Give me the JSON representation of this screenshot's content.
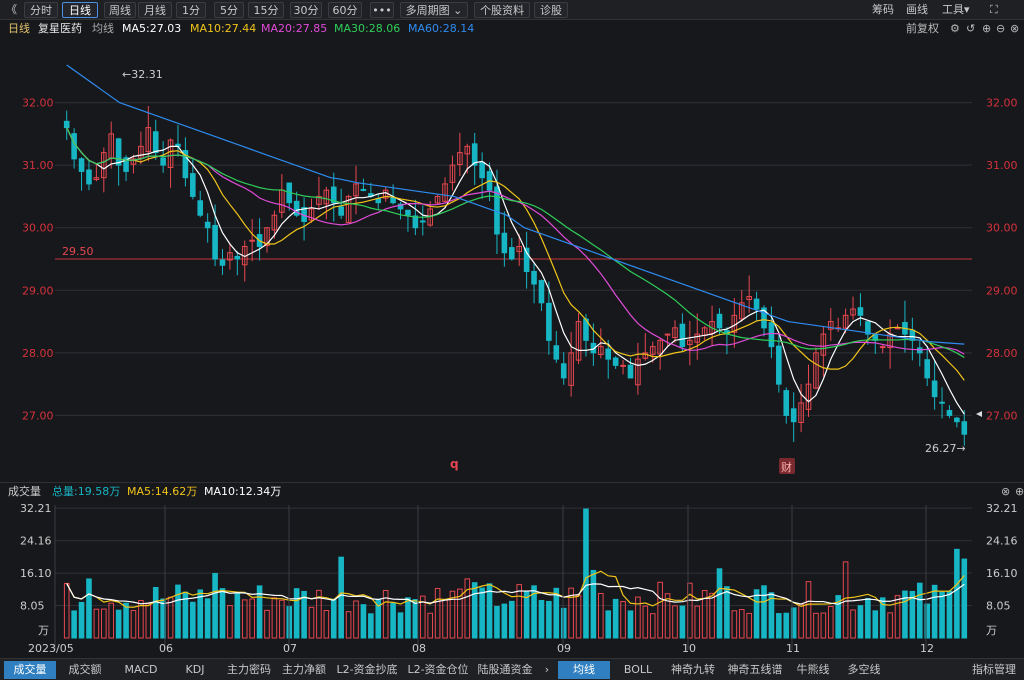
{
  "toolbar": {
    "back": "《",
    "periods": [
      "分时",
      "日线",
      "周线",
      "月线",
      "1分",
      "5分",
      "15分",
      "30分",
      "60分",
      "•••",
      "多周期图 ⌄",
      "个股资料",
      "诊股"
    ],
    "active": "日线",
    "right": [
      "筹码",
      "画线",
      "工具▾"
    ],
    "fullscreen": "⛶"
  },
  "ma_bar": {
    "period": "日线",
    "stock": "复星医药",
    "label": "均线",
    "ma5": "MA5:27.03",
    "ma10": "MA10:27.44",
    "ma20": "MA20:27.85",
    "ma30": "MA30:28.06",
    "ma60": "MA60:28.14",
    "adjust": "前复权"
  },
  "colors": {
    "up": "#e6474f",
    "down": "#17b6c4",
    "ma5": "#ffffff",
    "ma10": "#f0c419",
    "ma20": "#e04bd8",
    "ma30": "#2fce5a",
    "ma60": "#2e8cf0",
    "grid": "#2e3036",
    "axis": "#d4323c"
  },
  "volume_header": {
    "title": "成交量",
    "total": "总量:19.58万",
    "ma5": "MA5:14.62万",
    "ma10": "MA10:12.34万"
  },
  "bottom_tabs": [
    "成交量",
    "成交额",
    "MACD",
    "KDJ",
    "主力密码",
    "主力净额",
    "L2-资金抄底",
    "L2-资金仓位",
    "陆股通资金"
  ],
  "bottom_tabs_right": [
    "均线",
    "BOLL",
    "神奇九转",
    "神奇五线谱",
    "牛熊线",
    "多空线",
    "指标管理"
  ],
  "chart_data": [
    {
      "type": "candlestick",
      "title": "复星医药 日线",
      "y_ticks": [
        "32.00",
        "31.00",
        "30.00",
        "29.00",
        "28.00",
        "27.00"
      ],
      "ylim": [
        26.0,
        33.0
      ],
      "x_labels": [
        "06",
        "07",
        "08",
        "09",
        "10",
        "11",
        "12"
      ],
      "hline": {
        "value": 29.5,
        "label": "29.50"
      },
      "annotations": {
        "high": "32.31",
        "low": "26.27",
        "marker1": "q",
        "marker2": "财"
      },
      "series_closes": [
        31.6,
        31.1,
        30.9,
        30.7,
        30.8,
        31.2,
        31.5,
        31.0,
        30.9,
        31.1,
        31.3,
        31.6,
        31.2,
        31.0,
        31.4,
        31.3,
        30.8,
        30.5,
        30.2,
        30.0,
        29.5,
        29.4,
        29.6,
        29.5,
        29.7,
        29.8,
        29.7,
        30.0,
        30.2,
        30.6,
        30.4,
        30.2,
        30.1,
        30.3,
        30.5,
        30.6,
        30.4,
        30.2,
        30.5,
        30.7,
        30.6,
        30.5,
        30.4,
        30.6,
        30.4,
        30.3,
        30.2,
        30.0,
        30.1,
        30.3,
        30.5,
        30.7,
        31.0,
        31.2,
        31.3,
        31.0,
        30.8,
        30.6,
        29.9,
        29.6,
        29.5,
        29.7,
        29.3,
        29.1,
        28.8,
        28.2,
        27.9,
        27.6,
        28.0,
        28.5,
        28.2,
        28.0,
        28.1,
        27.9,
        27.8,
        27.8,
        27.6,
        27.9,
        28.0,
        28.1,
        28.2,
        28.3,
        28.4,
        28.1,
        28.2,
        28.3,
        28.4,
        28.5,
        28.4,
        28.3,
        28.6,
        28.8,
        28.9,
        28.7,
        28.4,
        28.1,
        27.5,
        27.0,
        26.9,
        27.2,
        27.5,
        28.0,
        28.3,
        28.5,
        28.4,
        28.6,
        28.7,
        28.6,
        28.3,
        28.2,
        28.1,
        28.3,
        28.4,
        28.3,
        28.2,
        28.0,
        27.6,
        27.3,
        27.2,
        27.0,
        26.9,
        26.7
      ],
      "ma60": [
        32.6,
        32.5,
        32.4,
        32.3,
        32.2,
        32.1,
        32.0,
        31.95,
        31.9,
        31.85,
        31.8,
        31.75,
        31.7,
        31.65,
        31.6,
        31.55,
        31.5,
        31.45,
        31.4,
        31.35,
        31.3,
        31.25,
        31.2,
        31.15,
        31.1,
        31.05,
        31.0,
        30.95,
        30.9,
        30.85,
        30.8,
        30.78,
        30.75,
        30.72,
        30.7,
        30.68,
        30.66,
        30.64,
        30.62,
        30.6,
        30.58,
        30.56,
        30.54,
        30.52,
        30.5,
        30.45,
        30.4,
        30.35,
        30.3,
        30.25,
        30.2,
        30.1,
        30.0,
        29.95,
        29.9,
        29.85,
        29.8,
        29.75,
        29.7,
        29.65,
        29.6,
        29.55,
        29.5,
        29.45,
        29.4,
        29.35,
        29.3,
        29.25,
        29.2,
        29.15,
        29.1,
        29.05,
        29.0,
        28.95,
        28.9,
        28.85,
        28.8,
        28.75,
        28.7,
        28.65,
        28.6,
        28.55,
        28.5,
        28.48,
        28.46,
        28.44,
        28.42,
        28.4,
        28.38,
        28.36,
        28.34,
        28.32,
        28.3,
        28.28,
        28.26,
        28.24,
        28.22,
        28.2,
        28.18,
        28.17,
        28.16,
        28.15,
        28.14
      ]
    },
    {
      "type": "bar",
      "title": "成交量",
      "y_ticks": [
        "32.21",
        "24.16",
        "16.10",
        "8.05"
      ],
      "unit": "万",
      "ylim": [
        0,
        33.0
      ]
    }
  ]
}
